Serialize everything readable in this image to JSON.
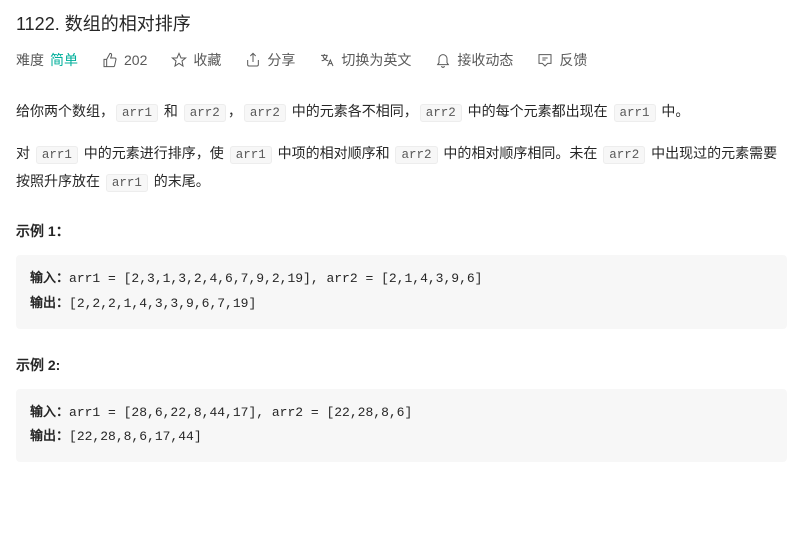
{
  "title": "1122. 数组的相对排序",
  "toolbar": {
    "difficulty_label": "难度",
    "difficulty_value": "简单",
    "likes": "202",
    "favorite": "收藏",
    "share": "分享",
    "switch_lang": "切换为英文",
    "subscribe": "接收动态",
    "feedback": "反馈"
  },
  "description": {
    "p1_1": "给你两个数组，",
    "p1_2": " 和 ",
    "p1_3": "，",
    "p1_4": " 中的元素各不相同，",
    "p1_5": " 中的每个元素都出现在 ",
    "p1_6": " 中。",
    "p2_1": "对 ",
    "p2_2": " 中的元素进行排序，使 ",
    "p2_3": " 中项的相对顺序和 ",
    "p2_4": " 中的相对顺序相同。未在 ",
    "p2_5": " 中出现过的元素需要按照升序放在 ",
    "p2_6": " 的末尾。",
    "arr1": "arr1",
    "arr2": "arr2"
  },
  "examples": {
    "e1_title": "示例 1：",
    "e2_title": "示例  2:",
    "input_label": "输入：",
    "output_label": "输出：",
    "e1_input": "arr1 = [2,3,1,3,2,4,6,7,9,2,19], arr2 = [2,1,4,3,9,6]",
    "e1_output": "[2,2,2,1,4,3,3,9,6,7,19]",
    "e2_input": "arr1 = [28,6,22,8,44,17], arr2 = [22,28,8,6]",
    "e2_output": "[22,28,8,6,17,44]"
  }
}
